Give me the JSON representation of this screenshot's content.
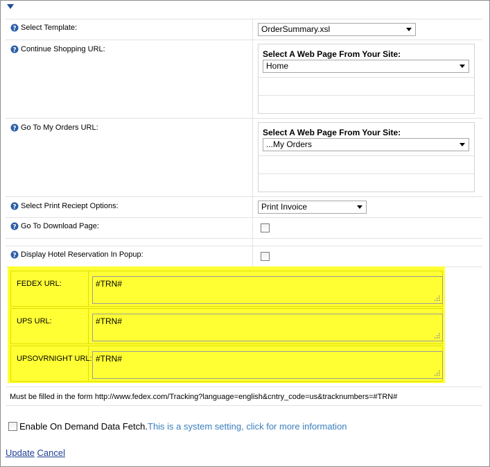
{
  "fields": {
    "select_template": {
      "label": "Select Template:",
      "value": "OrderSummary.xsl"
    },
    "continue_shopping": {
      "label": "Continue Shopping URL:",
      "picker_label": "Select A Web Page From Your Site:",
      "value": "Home"
    },
    "my_orders": {
      "label": "Go To My Orders URL:",
      "picker_label": "Select A Web Page From Your Site:",
      "value": "...My Orders"
    },
    "print_receipt": {
      "label": "Select Print Reciept Options:",
      "value": "Print Invoice"
    },
    "download_page": {
      "label": "Go To Download Page:",
      "checked": false
    },
    "hotel_popup": {
      "label": "Display Hotel Reservation In Popup:",
      "checked": false
    }
  },
  "tracking": [
    {
      "label": "FEDEX URL:",
      "value": "#TRN#"
    },
    {
      "label": "UPS URL:",
      "value": "#TRN#"
    },
    {
      "label": "UPSOVRNIGHT URL:",
      "value": "#TRN#"
    }
  ],
  "format_note": "Must be filled in the form http://www.fedex.com/Tracking?language=english&cntry_code=us&tracknumbers=#TRN#",
  "on_demand": {
    "label": "Enable On Demand Data Fetch.",
    "link": "This is a system setting, click for more information",
    "checked": false
  },
  "actions": {
    "update": "Update",
    "cancel": "Cancel"
  },
  "colors": {
    "highlight": "#ffff33",
    "link": "#3a7fbf",
    "action_link": "#1e3f95",
    "help_icon": "#2c5fa8"
  },
  "icons": {
    "help": "help-icon",
    "dropdown": "chevron-down-icon",
    "collapse": "caret-down-icon"
  }
}
